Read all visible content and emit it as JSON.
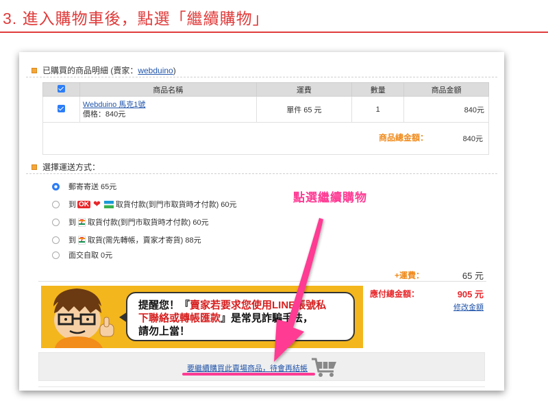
{
  "page": {
    "step_title": "3. 進入購物車後，點選「繼續購物」",
    "callout": "點選繼續購物"
  },
  "order": {
    "header_label": "已購買的商品明細 (賣家：",
    "header_close": ")",
    "seller": "webduino",
    "columns": {
      "name": "商品名稱",
      "shipping": "運費",
      "qty": "數量",
      "amount": "商品金額"
    },
    "item": {
      "name": "Webduino 馬克1號",
      "price": "價格：840元",
      "shipping": "單件 65 元",
      "qty": "1",
      "amount": "840元"
    },
    "total_label": "商品總金額：",
    "total_value": "840元"
  },
  "shipping": {
    "header": "選擇運送方式：",
    "to": "到",
    "options": [
      {
        "text": "郵寄寄送 65元",
        "selected": true
      },
      {
        "text": "取貨付款(到門市取貨時才付款) 60元",
        "logos": [
          "OK",
          "Hi-Life",
          "FamilyMart"
        ]
      },
      {
        "text": "取貨付款(到門市取貨時才付款) 60元",
        "logos": [
          "7-ELEVEN"
        ]
      },
      {
        "text": "取貨(需先轉帳，賣家才寄貨) 88元",
        "logos": [
          "7-ELEVEN"
        ]
      },
      {
        "text": "面交自取 0元"
      }
    ],
    "logo_ok": "OK",
    "logo_heart": "❤",
    "logo_711": "7"
  },
  "summary": {
    "fee_label": "+運費：",
    "fee_value": "65 元",
    "pay_label": "應付總金額：",
    "pay_value": "905 元",
    "modify_link": "修改金額"
  },
  "banner": {
    "line1a": "提醒您！『",
    "line1b": "賣家若要求您使用LINE帳號私",
    "line2a": "下聯絡或轉帳匯款",
    "line2b": "』是常見詐騙手法，",
    "line3": "請勿上當！"
  },
  "continue": {
    "link": "要繼續購買此賣場商品，待會再結帳"
  },
  "colors": {
    "title_red": "#e03a3a",
    "callout_pink": "#ff3a93",
    "accent_orange": "#f08a1a",
    "link_blue": "#2255aa",
    "banner_yellow": "#f3b61c"
  }
}
